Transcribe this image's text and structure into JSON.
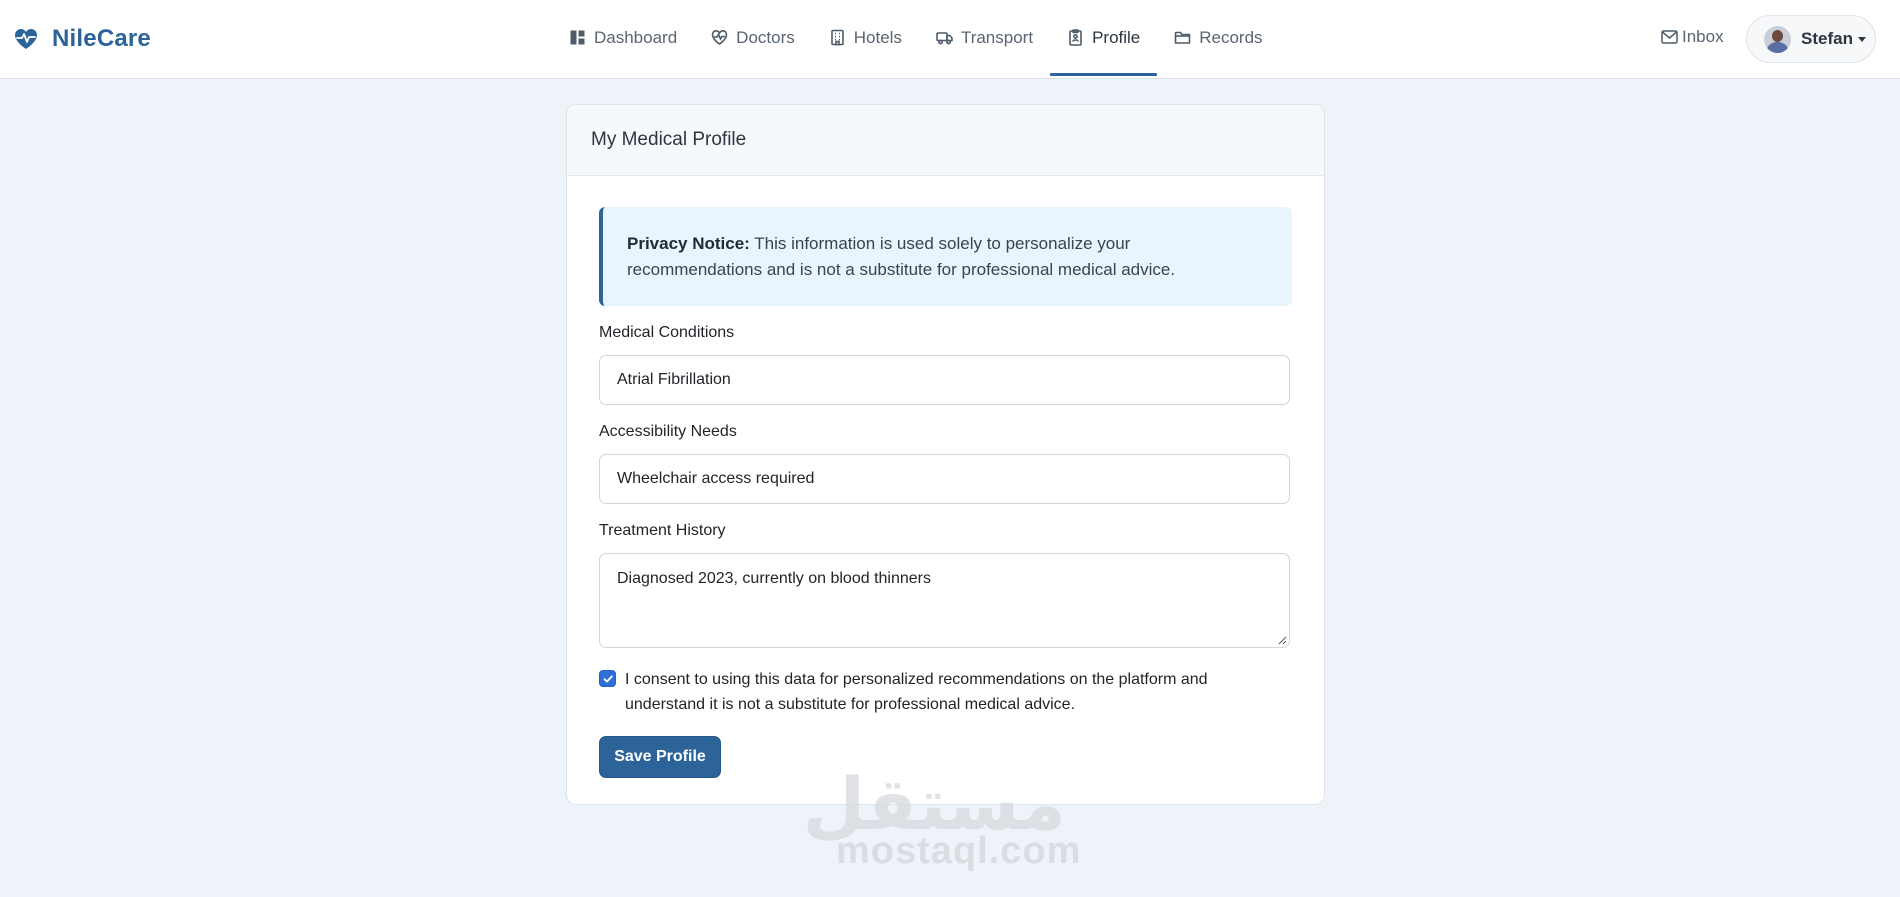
{
  "brand": {
    "name": "NileCare",
    "icon": "heart-pulse-icon",
    "color": "#2c6399"
  },
  "nav": {
    "items": [
      {
        "label": "Dashboard",
        "icon": "dashboard-icon",
        "active": false
      },
      {
        "label": "Doctors",
        "icon": "heart-icon",
        "active": false
      },
      {
        "label": "Hotels",
        "icon": "building-icon",
        "active": false
      },
      {
        "label": "Transport",
        "icon": "truck-icon",
        "active": false
      },
      {
        "label": "Profile",
        "icon": "clipboard-icon",
        "active": true
      },
      {
        "label": "Records",
        "icon": "folder-icon",
        "active": false
      }
    ],
    "inbox_label": "Inbox",
    "user_name": "Stefan"
  },
  "card": {
    "title": "My Medical Profile",
    "notice": {
      "title": "Privacy Notice:",
      "text": " This information is used solely to personalize your recommendations and is not a substitute for professional medical advice."
    },
    "fields": {
      "conditions": {
        "label": "Medical Conditions",
        "value": "Atrial Fibrillation"
      },
      "accessibility": {
        "label": "Accessibility Needs",
        "value": "Wheelchair access required"
      },
      "treatment": {
        "label": "Treatment History",
        "value": "Diagnosed 2023, currently on blood thinners"
      }
    },
    "consent": {
      "checked": true,
      "text": "I consent to using this data for personalized recommendations on the platform and understand it is not a substitute for professional medical advice."
    },
    "save_label": "Save Profile"
  },
  "watermark": {
    "arabic": "مستقل",
    "latin": "mostaql.com"
  },
  "colors": {
    "accent": "#2c6399",
    "background": "#eef3f9",
    "checkbox": "#2c6fd6",
    "notice_bg": "#e9f5fd"
  }
}
